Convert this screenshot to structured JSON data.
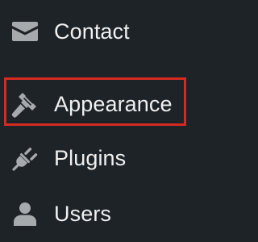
{
  "menu": {
    "items": [
      {
        "label": "Contact",
        "icon": "envelope-icon"
      },
      {
        "label": "Appearance",
        "icon": "paintbrush-icon"
      },
      {
        "label": "Plugins",
        "icon": "plugin-icon"
      },
      {
        "label": "Users",
        "icon": "user-icon"
      }
    ]
  },
  "colors": {
    "background": "#1d2327",
    "text": "#f0f0f1",
    "icon": "#a7aaad",
    "highlight": "#d42a20"
  }
}
